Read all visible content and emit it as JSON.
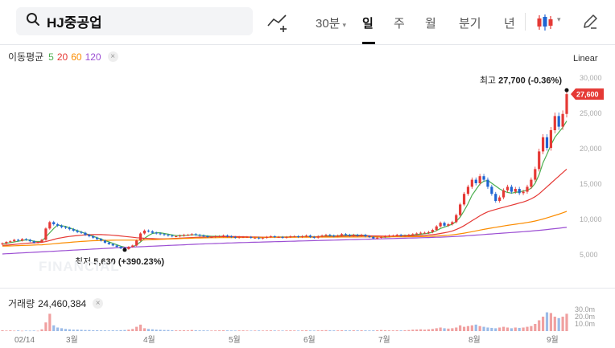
{
  "toolbar": {
    "stock_name": "HJ중공업",
    "intervals": [
      "30분",
      "일",
      "주",
      "월",
      "분기",
      "년"
    ],
    "active_interval": "일",
    "icons": [
      "search-icon",
      "compare-chart-icon",
      "candlestick-icon",
      "pencil-icon"
    ]
  },
  "indicators": {
    "ma_label": "이동평균",
    "ma_periods": [
      {
        "label": "5",
        "color": "#4caf50"
      },
      {
        "label": "20",
        "color": "#e53935"
      },
      {
        "label": "60",
        "color": "#fb8c00"
      },
      {
        "label": "120",
        "color": "#9c4fd3"
      }
    ],
    "scale_label": "Linear",
    "watermark": "FINANCIAL"
  },
  "annotations": {
    "high": {
      "label": "최고",
      "value": "27,700 (-0.36%)"
    },
    "low": {
      "label": "최저",
      "value": "5,630 (+390.23%)"
    },
    "current_price": "27,600"
  },
  "volume": {
    "label": "거래량",
    "value": "24,460,384",
    "axis_ticks": [
      "30.0m",
      "20.0m",
      "10.0m"
    ]
  },
  "colors": {
    "up": "#e53935",
    "down": "#1e64d2",
    "price_tag": "#e53935"
  },
  "chart_data": {
    "type": "candlestick",
    "y_axis_ticks": [
      "30,000",
      "25,000",
      "20,000",
      "15,000",
      "10,000",
      "5,000"
    ],
    "y_values": [
      30000,
      25000,
      20000,
      15000,
      10000,
      5000
    ],
    "x_axis_ticks": [
      "02/14",
      "3월",
      "4월",
      "5월",
      "6월",
      "7월",
      "8월",
      "9월"
    ],
    "closes": [
      6500,
      6700,
      6800,
      7000,
      6900,
      7100,
      7000,
      6800,
      6600,
      6700,
      7000,
      8600,
      9500,
      9200,
      9000,
      8800,
      8700,
      8500,
      8300,
      8100,
      8000,
      7700,
      7500,
      7300,
      7100,
      6900,
      6600,
      6400,
      6200,
      6000,
      5800,
      5700,
      6000,
      6200,
      6900,
      7900,
      8300,
      8200,
      8000,
      7900,
      7800,
      7700,
      7600,
      7500,
      7500,
      7600,
      7700,
      7700,
      7800,
      7700,
      7600,
      7500,
      7400,
      7400,
      7500,
      7500,
      7600,
      7500,
      7400,
      7300,
      7400,
      7400,
      7400,
      7300,
      7300,
      7200,
      7300,
      7400,
      7500,
      7400,
      7400,
      7300,
      7400,
      7500,
      7500,
      7400,
      7500,
      7600,
      7400,
      7300,
      7500,
      7600,
      7700,
      7600,
      7500,
      7600,
      7800,
      7700,
      7600,
      7700,
      7600,
      7700,
      7500,
      7400,
      7200,
      7300,
      7400,
      7500,
      7600,
      7600,
      7700,
      7600,
      7600,
      7700,
      7800,
      7900,
      8000,
      8000,
      8100,
      8400,
      8900,
      9400,
      9000,
      9200,
      9500,
      10500,
      12000,
      13500,
      14500,
      15500,
      15000,
      16000,
      15500,
      14500,
      13500,
      12500,
      13000,
      14000,
      14500,
      13800,
      14200,
      13600,
      13800,
      14500,
      15500,
      17000,
      19500,
      21500,
      20000,
      22500,
      24500,
      23000,
      24800,
      27600
    ],
    "ma": [
      {
        "period": 5,
        "values": [
          6400,
          6500,
          6600,
          6700,
          6800,
          6900,
          7000,
          6950,
          6800,
          6750,
          6800,
          7400,
          8000,
          8600,
          9100,
          9000,
          8900,
          8700,
          8500,
          8300,
          8100,
          7900,
          7700,
          7500,
          7300,
          7100,
          6900,
          6700,
          6500,
          6300,
          6100,
          5950,
          5900,
          6000,
          6300,
          6700,
          7200,
          7600,
          7900,
          8000,
          8000,
          7900,
          7800,
          7700,
          7600,
          7600,
          7600,
          7650,
          7700,
          7700,
          7650,
          7600,
          7550,
          7500,
          7500,
          7500,
          7500,
          7500,
          7450,
          7400,
          7400,
          7400,
          7400,
          7350,
          7350,
          7300,
          7300,
          7350,
          7400,
          7400,
          7400,
          7400,
          7400,
          7420,
          7440,
          7440,
          7460,
          7480,
          7460,
          7440,
          7460,
          7500,
          7540,
          7560,
          7560,
          7580,
          7640,
          7660,
          7660,
          7680,
          7660,
          7660,
          7620,
          7560,
          7480,
          7420,
          7380,
          7360,
          7400,
          7480,
          7560,
          7600,
          7620,
          7640,
          7680,
          7740,
          7800,
          7860,
          7940,
          8080,
          8300,
          8600,
          8800,
          9000,
          9200,
          9600,
          10200,
          11100,
          12100,
          13300,
          14100,
          14900,
          15300,
          15400,
          15000,
          14600,
          14200,
          13900,
          13700,
          13600,
          13700,
          13800,
          13900,
          14000,
          14300,
          15000,
          16200,
          17900,
          19100,
          20400,
          21500,
          22200,
          22900,
          23800
        ]
      },
      {
        "period": 20,
        "values": [
          6200,
          6250,
          6300,
          6350,
          6400,
          6450,
          6500,
          6550,
          6580,
          6600,
          6650,
          6750,
          6900,
          7050,
          7200,
          7300,
          7400,
          7480,
          7550,
          7600,
          7650,
          7700,
          7720,
          7740,
          7750,
          7740,
          7720,
          7690,
          7650,
          7600,
          7540,
          7480,
          7420,
          7360,
          7300,
          7260,
          7220,
          7190,
          7170,
          7150,
          7140,
          7140,
          7150,
          7170,
          7200,
          7230,
          7260,
          7290,
          7320,
          7350,
          7370,
          7390,
          7400,
          7410,
          7420,
          7430,
          7440,
          7450,
          7450,
          7450,
          7440,
          7430,
          7420,
          7410,
          7400,
          7390,
          7380,
          7380,
          7380,
          7380,
          7380,
          7380,
          7380,
          7380,
          7390,
          7400,
          7410,
          7420,
          7420,
          7420,
          7430,
          7440,
          7450,
          7460,
          7470,
          7480,
          7500,
          7520,
          7530,
          7540,
          7550,
          7560,
          7560,
          7560,
          7550,
          7540,
          7530,
          7520,
          7520,
          7520,
          7530,
          7540,
          7550,
          7560,
          7570,
          7590,
          7610,
          7640,
          7680,
          7730,
          7800,
          7900,
          8000,
          8100,
          8250,
          8450,
          8700,
          9000,
          9350,
          9700,
          10050,
          10400,
          10700,
          10950,
          11150,
          11300,
          11450,
          11600,
          11750,
          11900,
          12050,
          12200,
          12350,
          12550,
          12800,
          13100,
          13500,
          14000,
          14500,
          15000,
          15500,
          16000,
          16500,
          17000
        ]
      },
      {
        "period": 60,
        "values": [
          6100,
          6120,
          6140,
          6160,
          6180,
          6200,
          6220,
          6240,
          6260,
          6280,
          6300,
          6340,
          6390,
          6440,
          6490,
          6540,
          6590,
          6640,
          6690,
          6730,
          6770,
          6810,
          6840,
          6870,
          6890,
          6910,
          6920,
          6930,
          6940,
          6950,
          6950,
          6950,
          6950,
          6950,
          6960,
          6970,
          6990,
          7010,
          7030,
          7050,
          7070,
          7090,
          7110,
          7130,
          7150,
          7170,
          7190,
          7210,
          7230,
          7250,
          7260,
          7270,
          7280,
          7290,
          7300,
          7305,
          7310,
          7315,
          7320,
          7325,
          7330,
          7335,
          7340,
          7345,
          7350,
          7352,
          7354,
          7356,
          7358,
          7360,
          7362,
          7364,
          7366,
          7368,
          7370,
          7372,
          7374,
          7376,
          7378,
          7380,
          7382,
          7384,
          7386,
          7388,
          7390,
          7392,
          7394,
          7396,
          7398,
          7400,
          7402,
          7404,
          7406,
          7408,
          7410,
          7412,
          7414,
          7416,
          7418,
          7420,
          7425,
          7430,
          7435,
          7440,
          7445,
          7450,
          7460,
          7470,
          7480,
          7500,
          7530,
          7570,
          7610,
          7650,
          7700,
          7770,
          7850,
          7940,
          8040,
          8150,
          8260,
          8370,
          8480,
          8580,
          8680,
          8770,
          8860,
          8950,
          9040,
          9120,
          9200,
          9280,
          9360,
          9450,
          9550,
          9660,
          9790,
          9940,
          10100,
          10270,
          10450,
          10630,
          10820,
          11020
        ]
      },
      {
        "period": 120,
        "values": [
          5000,
          5030,
          5060,
          5090,
          5120,
          5150,
          5180,
          5210,
          5240,
          5270,
          5300,
          5330,
          5360,
          5390,
          5420,
          5450,
          5480,
          5510,
          5540,
          5570,
          5600,
          5630,
          5660,
          5690,
          5720,
          5750,
          5780,
          5810,
          5840,
          5870,
          5900,
          5925,
          5950,
          5975,
          6000,
          6025,
          6050,
          6075,
          6100,
          6125,
          6150,
          6175,
          6200,
          6225,
          6250,
          6275,
          6300,
          6325,
          6350,
          6375,
          6400,
          6420,
          6440,
          6460,
          6480,
          6500,
          6520,
          6540,
          6560,
          6580,
          6600,
          6615,
          6630,
          6645,
          6660,
          6675,
          6690,
          6705,
          6720,
          6735,
          6750,
          6765,
          6780,
          6795,
          6810,
          6825,
          6840,
          6855,
          6870,
          6885,
          6900,
          6915,
          6930,
          6945,
          6960,
          6975,
          6990,
          7005,
          7020,
          7035,
          7050,
          7065,
          7080,
          7095,
          7110,
          7125,
          7140,
          7155,
          7170,
          7185,
          7200,
          7215,
          7230,
          7245,
          7260,
          7275,
          7290,
          7305,
          7320,
          7340,
          7360,
          7380,
          7400,
          7425,
          7450,
          7480,
          7510,
          7550,
          7590,
          7630,
          7670,
          7710,
          7750,
          7790,
          7830,
          7870,
          7910,
          7950,
          7990,
          8030,
          8070,
          8110,
          8150,
          8190,
          8240,
          8290,
          8340,
          8400,
          8460,
          8520,
          8580,
          8640,
          8700,
          8760
        ]
      }
    ],
    "volume_values": [
      1.2,
      0.8,
      1.0,
      0.6,
      0.9,
      0.5,
      0.7,
      0.6,
      0.8,
      0.5,
      2.5,
      12.0,
      24.0,
      8.0,
      5.0,
      4.0,
      3.0,
      2.5,
      2.0,
      2.0,
      1.8,
      1.5,
      1.5,
      1.2,
      1.2,
      1.0,
      1.0,
      0.9,
      1.1,
      1.0,
      1.3,
      1.5,
      2.0,
      3.0,
      6.0,
      9.0,
      4.0,
      3.0,
      2.5,
      2.0,
      1.8,
      1.5,
      1.5,
      1.2,
      1.0,
      1.0,
      1.2,
      1.0,
      1.5,
      1.2,
      1.0,
      1.0,
      0.9,
      0.8,
      0.9,
      1.0,
      1.1,
      1.0,
      0.9,
      0.8,
      0.9,
      1.0,
      0.8,
      0.7,
      0.8,
      0.9,
      0.8,
      0.9,
      1.0,
      0.9,
      0.8,
      0.8,
      0.9,
      1.0,
      0.9,
      0.8,
      1.0,
      1.1,
      0.9,
      0.8,
      1.0,
      1.2,
      1.3,
      1.1,
      1.0,
      1.0,
      1.2,
      1.1,
      1.0,
      1.1,
      1.0,
      1.1,
      1.0,
      0.9,
      1.0,
      1.2,
      1.5,
      1.2,
      1.0,
      1.0,
      1.1,
      1.0,
      1.2,
      1.5,
      2.0,
      2.2,
      2.5,
      2.0,
      2.5,
      3.0,
      4.0,
      5.0,
      4.0,
      3.5,
      4.0,
      5.0,
      8.0,
      6.0,
      7.0,
      8.0,
      9.0,
      7.0,
      6.0,
      5.0,
      4.5,
      4.0,
      5.0,
      6.0,
      5.0,
      4.0,
      5.0,
      4.5,
      5.0,
      6.0,
      7.0,
      10.0,
      15.0,
      20.0,
      26.0,
      25.0,
      20.0,
      18.0,
      20.0,
      24.0
    ]
  }
}
